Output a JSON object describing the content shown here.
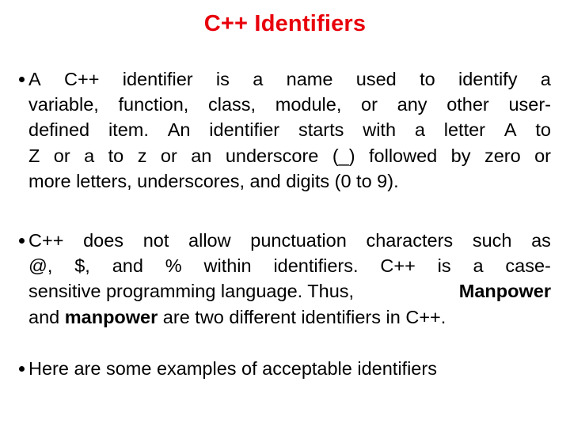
{
  "slide": {
    "title": "C++ Identifiers",
    "title_color": "#e8000b",
    "bullets": [
      {
        "lines": [
          {
            "justify": true,
            "words": [
              "A",
              "C++",
              "identifier",
              "is",
              "a",
              "name",
              "used",
              "to",
              "identify",
              "a"
            ]
          },
          {
            "justify": true,
            "words": [
              "variable,",
              "function,",
              "class,",
              "module,",
              "or",
              "any",
              "other",
              "user-"
            ]
          },
          {
            "justify": true,
            "words": [
              "defined",
              "item.",
              "An",
              "identifier",
              "starts",
              "with",
              "a",
              "letter",
              "A",
              "to"
            ]
          },
          {
            "justify": true,
            "words": [
              "Z",
              "or",
              "a",
              "to",
              "z",
              "or",
              "an",
              "underscore",
              "(_)",
              "followed",
              "by",
              "zero",
              "or"
            ]
          },
          {
            "justify": false,
            "text": "more letters, underscores, and digits (0 to 9)."
          }
        ],
        "full_text": "A C++ identifier is a name used to identify a variable, function, class, module, or any other user-defined item. An identifier starts with a letter A to Z or a to z or an underscore (_) followed by zero or more letters, underscores, and digits (0 to 9)."
      },
      {
        "lines": [
          {
            "justify": true,
            "words": [
              "C++",
              "does",
              "not",
              "allow",
              "punctuation",
              "characters",
              "such",
              "as"
            ]
          },
          {
            "justify": true,
            "words": [
              "@,",
              "$,",
              "and",
              "%",
              "within",
              "identifiers.",
              "C++",
              "is",
              "a",
              "case-"
            ]
          },
          {
            "justify": true,
            "parts": [
              {
                "text": "sensitive programming language. Thus, ",
                "bold": false
              },
              {
                "text": "Manpower",
                "bold": true
              }
            ]
          },
          {
            "justify": false,
            "parts": [
              {
                "text": "and ",
                "bold": false
              },
              {
                "text": "manpower",
                "bold": true
              },
              {
                "text": " are two different identifiers in C++.",
                "bold": false
              }
            ]
          }
        ],
        "full_text": "C++ does not allow punctuation characters such as @, $, and % within identifiers. C++ is a case-sensitive programming language. Thus, Manpower and manpower are two different identifiers in C++."
      },
      {
        "lines": [
          {
            "justify": false,
            "text": "Here are some examples of acceptable identifiers"
          }
        ],
        "full_text": "Here are some examples of acceptable identifiers"
      }
    ]
  }
}
